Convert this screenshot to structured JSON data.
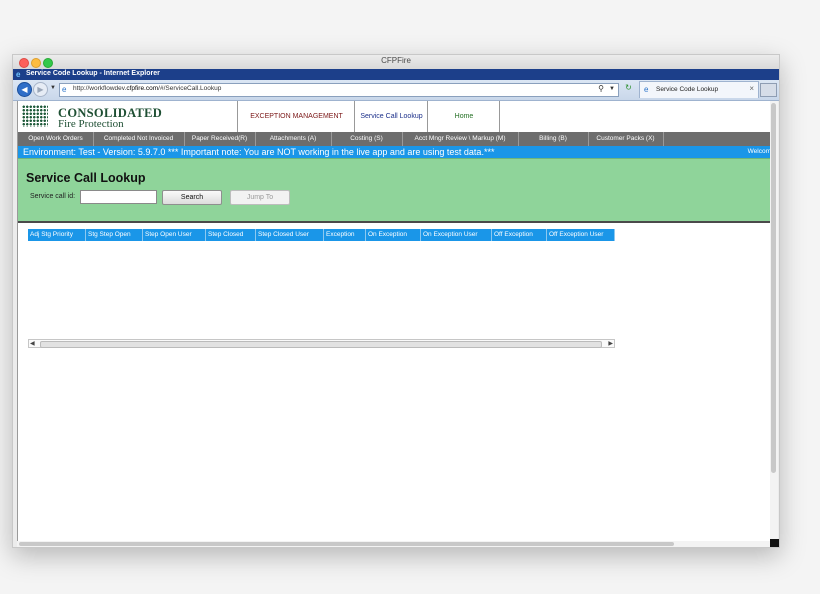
{
  "mac_window": {
    "title": "CFPFire"
  },
  "ie_window": {
    "title": "Service Code Lookup - Internet Explorer"
  },
  "toolbar": {
    "url_prefix": "http://workflowdev.",
    "url_domain": "cfpfire.com",
    "url_path": "/#/ServiceCall.Lookup",
    "tab_title": "Service Code Lookup",
    "tab_close": "×"
  },
  "header": {
    "logo_name": "CONSOLIDATED",
    "logo_sub": "Fire Protection",
    "tabs": {
      "exception": "EXCEPTION MANAGEMENT",
      "service_call": "Service Call Lookup",
      "home": "Home"
    }
  },
  "menu": [
    "Open Work Orders",
    "Completed Not Invoiced",
    "Paper Received(R)",
    "Attachments (A)",
    "Costing (S)",
    "Acct Mngr Review \\ Markup (M)",
    "Billing (B)",
    "Customer Packs (X)"
  ],
  "env_banner": {
    "text": "Environment: Test - Version: 5.9.7.0 *** Important note: You are NOT working in the live app and are using test data.***",
    "welcome": "Welcom"
  },
  "lookup": {
    "title": "Service Call Lookup",
    "id_label": "Service call id:",
    "id_value": "",
    "search_button": "Search",
    "jump_button": "Jump To"
  },
  "grid": {
    "columns": [
      "Adj Stg Priority",
      "Stg Step Open",
      "Step Open User",
      "Step Closed",
      "Step Closed User",
      "Exception",
      "On Exception",
      "On Exception User",
      "Off Exception",
      "Off Exception User"
    ]
  },
  "colors": {
    "accent_blue": "#1a96e8",
    "panel_green": "#8fd49a",
    "menu_gray": "#6d6d6d",
    "logo_green": "#1e4f33"
  }
}
